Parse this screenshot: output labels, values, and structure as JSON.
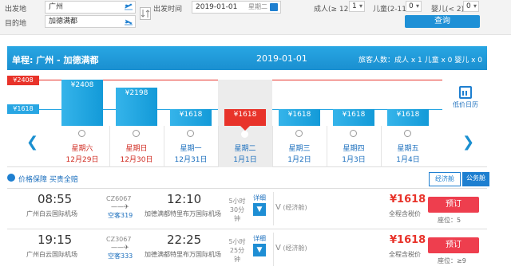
{
  "search": {
    "depart_label": "出发地",
    "dest_label": "目的地",
    "depart_value": "广州",
    "dest_value": "加德满都",
    "time_label": "出发时间",
    "date_value": "2019-01-01",
    "weekday_value": "星期二",
    "adult_label": "成人(≥ 12)",
    "adult_value": "1",
    "child_label": "儿童(2-11)",
    "child_value": "0",
    "infant_label": "婴儿(< 2)",
    "infant_value": "0",
    "query_label": "查询"
  },
  "header": {
    "route": "单程:  广州 - 加德满都",
    "date": "2019-01-01",
    "passengers": "旅客人数：成人 x 1   儿童 x 0   婴儿 x 0"
  },
  "calendar": {
    "max_price": "¥2408",
    "min_price": "¥1618",
    "low_price_calendar": "低价日历",
    "days": [
      {
        "price": "¥2408",
        "value": 2408,
        "weekday": "星期六",
        "date": "12月29日",
        "weekend": true,
        "selected": false
      },
      {
        "price": "¥2198",
        "value": 2198,
        "weekday": "星期日",
        "date": "12月30日",
        "weekend": true,
        "selected": false
      },
      {
        "price": "¥1618",
        "value": 1618,
        "weekday": "星期一",
        "date": "12月31日",
        "weekend": false,
        "selected": false
      },
      {
        "price": "¥1618",
        "value": 1618,
        "weekday": "星期二",
        "date": "1月1日",
        "weekend": false,
        "selected": true
      },
      {
        "price": "¥1618",
        "value": 1618,
        "weekday": "星期三",
        "date": "1月2日",
        "weekend": false,
        "selected": false
      },
      {
        "price": "¥1618",
        "value": 1618,
        "weekday": "星期四",
        "date": "1月3日",
        "weekend": false,
        "selected": false
      },
      {
        "price": "¥1618",
        "value": 1618,
        "weekday": "星期五",
        "date": "1月4日",
        "weekend": false,
        "selected": false
      }
    ]
  },
  "info": {
    "guarantee": "价格保障 买贵全赔",
    "tab_economy": "经济舱",
    "tab_business": "公务舱"
  },
  "flights": [
    {
      "dep_time": "08:55",
      "dep_airport": "广州白云国际机场",
      "flight_no": "CZ6067",
      "aircraft": "空客319",
      "arr_time": "12:10",
      "arr_airport": "加德满都特里布万国际机场",
      "dur_h": "5小时",
      "dur_m": "30分钟",
      "detail": "详细",
      "cabin": "V",
      "cabin_note": "(经济舱)",
      "price": "¥1618",
      "price_note": "全程含税价",
      "book": "预订",
      "seats": "座位：5"
    },
    {
      "dep_time": "19:15",
      "dep_airport": "广州白云国际机场",
      "flight_no": "CZ3067",
      "aircraft": "空客333",
      "arr_time": "22:25",
      "arr_airport": "加德满都特里布万国际机场",
      "dur_h": "5小时",
      "dur_m": "25分钟",
      "detail": "详细",
      "cabin": "V",
      "cabin_note": "(经济舱)",
      "price": "¥1618",
      "price_note": "全程含税价",
      "book": "预订",
      "seats": "座位：≥9"
    }
  ]
}
